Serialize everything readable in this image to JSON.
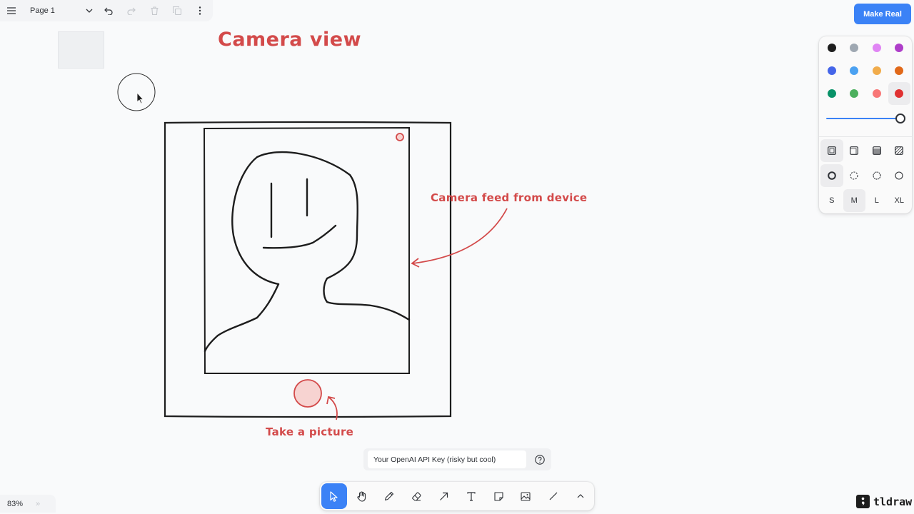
{
  "menu": {
    "page_name": "Page 1"
  },
  "make_real": {
    "label": "Make Real",
    "color": "#3b82f6"
  },
  "canvas": {
    "title": "Camera view",
    "feed_label": "Camera feed from device",
    "picture_label": "Take a picture",
    "ink_color": "#d34a4a"
  },
  "style_panel": {
    "colors": [
      {
        "name": "black",
        "hex": "#1d1d1d"
      },
      {
        "name": "grey",
        "hex": "#9fa8b2"
      },
      {
        "name": "light-violet",
        "hex": "#e085f4"
      },
      {
        "name": "violet",
        "hex": "#ae3ec9"
      },
      {
        "name": "blue",
        "hex": "#4465e9"
      },
      {
        "name": "light-blue",
        "hex": "#4ba1f1"
      },
      {
        "name": "yellow",
        "hex": "#f1ac4b"
      },
      {
        "name": "orange",
        "hex": "#e16919"
      },
      {
        "name": "green",
        "hex": "#099268"
      },
      {
        "name": "light-green",
        "hex": "#4cb05e"
      },
      {
        "name": "light-red",
        "hex": "#f87777"
      },
      {
        "name": "red",
        "hex": "#e03131"
      }
    ],
    "selected_color": "red",
    "opacity": 1.0,
    "sizes": [
      "S",
      "M",
      "L",
      "XL"
    ],
    "selected_size": "M"
  },
  "api_key": {
    "placeholder": "Your OpenAI API Key (risky but cool)"
  },
  "zoom": {
    "label": "83%",
    "minimap_icon": "»"
  },
  "brand": {
    "name": "tldraw"
  }
}
